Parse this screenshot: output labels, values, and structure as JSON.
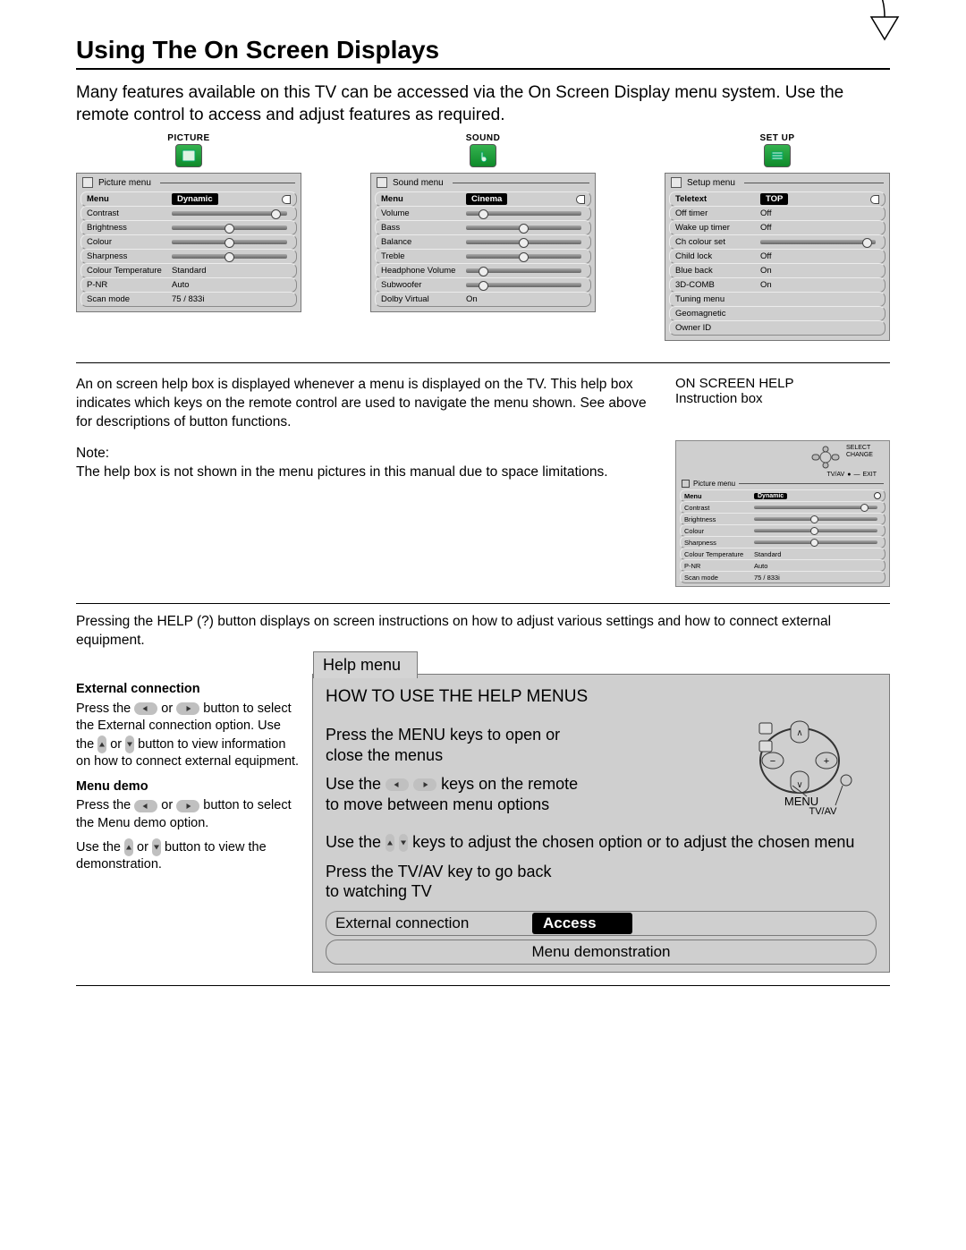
{
  "title": "Using The On Screen Displays",
  "intro": "Many features available on this TV can be accessed via the On Screen Display menu system. Use the remote control to access and adjust features as required.",
  "menus": {
    "picture": {
      "header": "PICTURE",
      "panel_title": "Picture menu",
      "rows": [
        {
          "label": "Menu",
          "type": "selected",
          "value": "Dynamic"
        },
        {
          "label": "Contrast",
          "type": "slider",
          "pos": 0.9
        },
        {
          "label": "Brightness",
          "type": "slider",
          "pos": 0.5
        },
        {
          "label": "Colour",
          "type": "slider",
          "pos": 0.5
        },
        {
          "label": "Sharpness",
          "type": "slider",
          "pos": 0.5
        },
        {
          "label": "Colour Temperature",
          "type": "text",
          "value": "Standard"
        },
        {
          "label": "P-NR",
          "type": "text",
          "value": "Auto"
        },
        {
          "label": "Scan mode",
          "type": "text",
          "value": "75 / 833i"
        }
      ]
    },
    "sound": {
      "header": "SOUND",
      "panel_title": "Sound menu",
      "rows": [
        {
          "label": "Menu",
          "type": "selected",
          "value": "Cinema"
        },
        {
          "label": "Volume",
          "type": "slider",
          "pos": 0.15
        },
        {
          "label": "Bass",
          "type": "slider",
          "pos": 0.5
        },
        {
          "label": "Balance",
          "type": "slider",
          "pos": 0.5
        },
        {
          "label": "Treble",
          "type": "slider",
          "pos": 0.5
        },
        {
          "label": "Headphone Volume",
          "type": "slider",
          "pos": 0.15
        },
        {
          "label": "Subwoofer",
          "type": "slider",
          "pos": 0.15
        },
        {
          "label": "Dolby Virtual",
          "type": "text",
          "value": "On"
        }
      ]
    },
    "setup": {
      "header": "SET UP",
      "panel_title": "Setup menu",
      "rows": [
        {
          "label": "Teletext",
          "type": "selected",
          "value": "TOP"
        },
        {
          "label": "Off timer",
          "type": "text",
          "value": "Off"
        },
        {
          "label": "Wake up timer",
          "type": "text",
          "value": "Off"
        },
        {
          "label": "Ch colour set",
          "type": "slider",
          "pos": 0.92
        },
        {
          "label": "Child lock",
          "type": "text",
          "value": "Off"
        },
        {
          "label": "Blue back",
          "type": "text",
          "value": "On"
        },
        {
          "label": "3D-COMB",
          "type": "text",
          "value": "On"
        },
        {
          "label": "Tuning menu",
          "type": "text",
          "value": ""
        },
        {
          "label": "Geomagnetic",
          "type": "text",
          "value": ""
        },
        {
          "label": "Owner ID",
          "type": "text",
          "value": ""
        }
      ]
    }
  },
  "help_section": {
    "p1": "An on screen help box is displayed whenever a menu is displayed on the TV. This help box indicates which keys on the remote control are used to navigate the menu shown. See above for descriptions of button functions.",
    "note_label": "Note:",
    "note": "The help box is not shown in the menu pictures in this manual due to space limitations.",
    "label1": "ON SCREEN HELP",
    "label2": "Instruction box",
    "mini": {
      "select": "SELECT",
      "change": "CHANGE",
      "tvav": "TV/AV",
      "exit": "EXIT",
      "panel_title": "Picture menu",
      "rows": [
        {
          "label": "Menu",
          "type": "selected",
          "value": "Dynamic"
        },
        {
          "label": "Contrast",
          "type": "slider",
          "pos": 0.9
        },
        {
          "label": "Brightness",
          "type": "slider",
          "pos": 0.5
        },
        {
          "label": "Colour",
          "type": "slider",
          "pos": 0.5
        },
        {
          "label": "Sharpness",
          "type": "slider",
          "pos": 0.5
        },
        {
          "label": "Colour Temperature",
          "type": "text",
          "value": "Standard"
        },
        {
          "label": "P-NR",
          "type": "text",
          "value": "Auto"
        },
        {
          "label": "Scan mode",
          "type": "text",
          "value": "75 / 833i"
        }
      ]
    }
  },
  "s3intro": "Pressing the HELP (?) button displays on screen instructions on how to adjust various settings and how to connect external equipment.",
  "ext": {
    "h": "External connection",
    "p1a": "Press the ",
    "p1b": " or ",
    "p1c": " button to select the External connection option. Use the ",
    "p1d": " or ",
    "p1e": " button to view information on how to connect external equipment."
  },
  "demo": {
    "h": "Menu demo",
    "p1a": "Press the ",
    "p1b": " or ",
    "p1c": " button to select the Menu demo option.",
    "p2a": "Use the ",
    "p2b": " or ",
    "p2c": " button to view the demonstration."
  },
  "helpmenu": {
    "tab": "Help menu",
    "h": "HOW TO USE THE HELP MENUS",
    "p1": "Press the MENU keys to open or close the menus",
    "p2a": "Use the ",
    "p2b": " keys on the remote to move between menu options",
    "p3a": "Use the ",
    "p3b": " keys to adjust the chosen option or to adjust the chosen menu",
    "p4": "Press the TV/AV key to go back to watching TV",
    "nav_menu": "MENU",
    "nav_tvav": "TV/AV",
    "row1": "External connection",
    "row1_pill": "Access",
    "row2": "Menu demonstration"
  }
}
